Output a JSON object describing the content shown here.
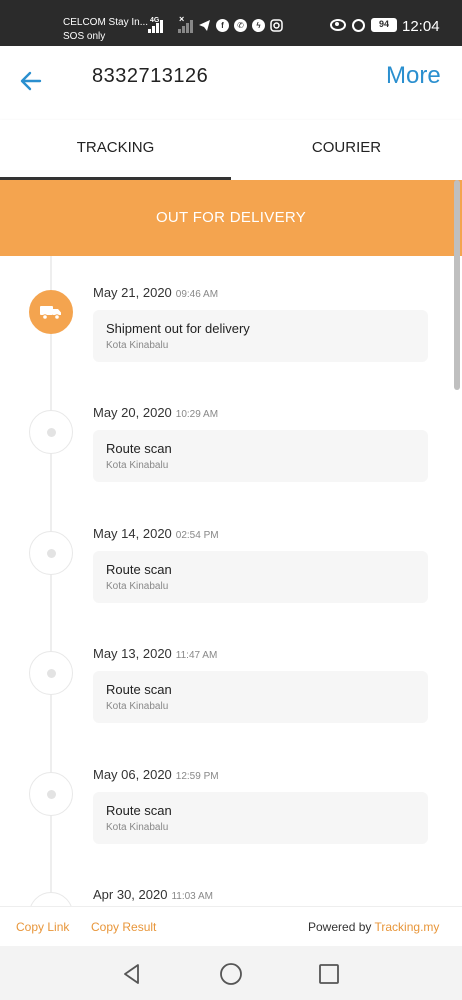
{
  "status_bar": {
    "carrier_line1": "CELCOM Stay In...",
    "carrier_line2": "SOS only",
    "network": "4G",
    "battery": "94",
    "time": "12:04"
  },
  "app_bar": {
    "title": "8332713126",
    "more_label": "More"
  },
  "tabs": [
    {
      "label": "TRACKING",
      "active": true
    },
    {
      "label": "COURIER",
      "active": false
    }
  ],
  "banner": {
    "status": "OUT FOR DELIVERY",
    "color": "#f4a44f"
  },
  "events": [
    {
      "date": "May 21, 2020",
      "time": "09:46 AM",
      "status": "Shipment out for delivery",
      "location": "Kota Kinabalu",
      "icon": "truck-icon",
      "active": true
    },
    {
      "date": "May 20, 2020",
      "time": "10:29 AM",
      "status": "Route scan",
      "location": "Kota Kinabalu",
      "active": false
    },
    {
      "date": "May 14, 2020",
      "time": "02:54 PM",
      "status": "Route scan",
      "location": "Kota Kinabalu",
      "active": false
    },
    {
      "date": "May 13, 2020",
      "time": "11:47 AM",
      "status": "Route scan",
      "location": "Kota Kinabalu",
      "active": false
    },
    {
      "date": "May 06, 2020",
      "time": "12:59 PM",
      "status": "Route scan",
      "location": "Kota Kinabalu",
      "active": false
    },
    {
      "date": "Apr 30, 2020",
      "time": "11:03 AM",
      "active": false
    }
  ],
  "footer": {
    "copy_link": "Copy Link",
    "copy_result": "Copy Result",
    "powered_by": "Powered by",
    "brand": "Tracking.my"
  },
  "colors": {
    "accent": "#2a8fcf",
    "orange": "#f4a44f"
  }
}
